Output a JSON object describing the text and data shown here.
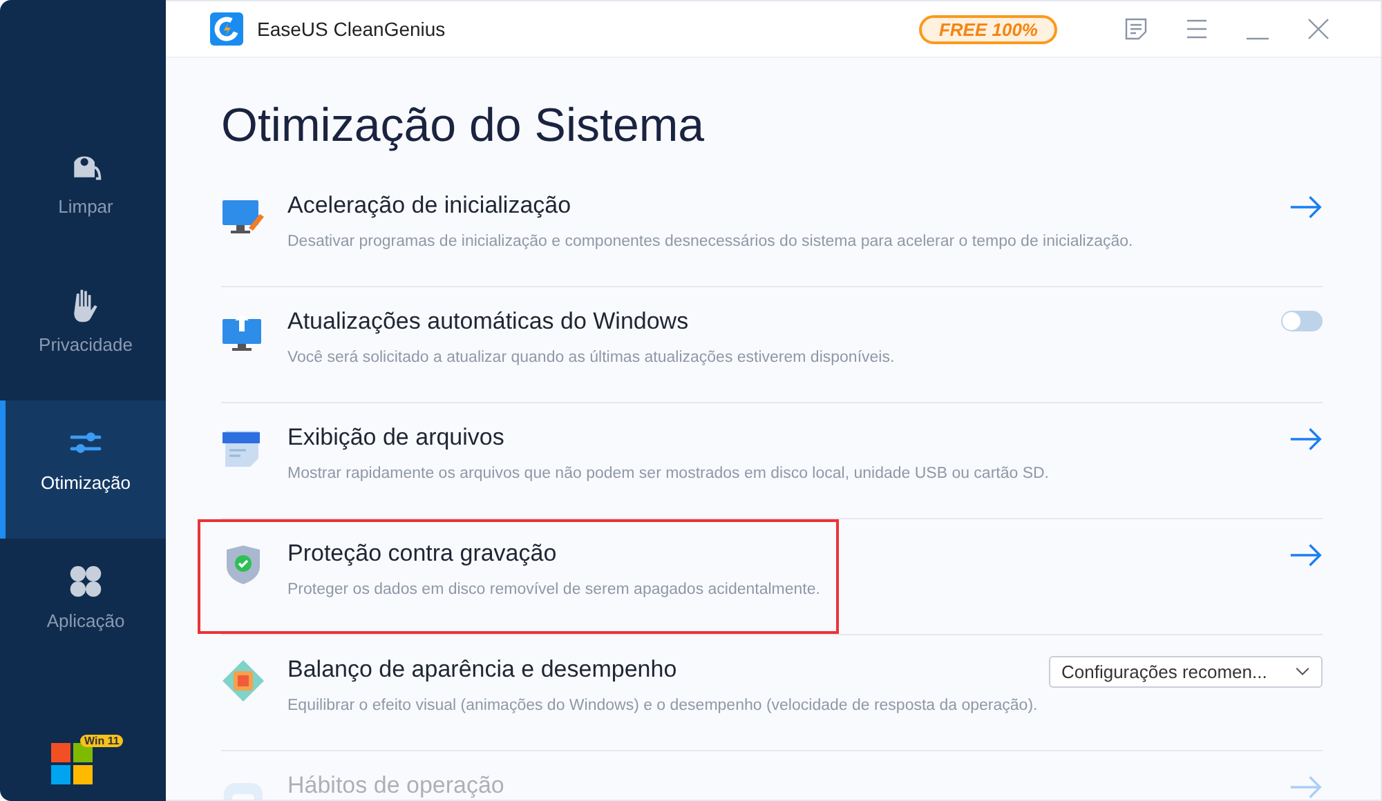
{
  "app": {
    "title": "EaseUS CleanGenius",
    "badge": "FREE 100%"
  },
  "sidebar": {
    "items": [
      {
        "label": "Limpar",
        "selected": false
      },
      {
        "label": "Privacidade",
        "selected": false
      },
      {
        "label": "Otimização",
        "selected": true
      },
      {
        "label": "Aplicação",
        "selected": false
      }
    ],
    "os_badge": "Win 11"
  },
  "heading": "Otimização do Sistema",
  "items": [
    {
      "kind": "arrow",
      "title": "Aceleração de inicialização",
      "description": "Desativar programas de inicialização e componentes desnecessários do sistema para acelerar o tempo de inicialização.",
      "highlighted": false,
      "dimmed": false
    },
    {
      "kind": "toggle",
      "title": "Atualizações automáticas do Windows",
      "description": "Você será solicitado a atualizar quando as últimas atualizações estiverem disponíveis.",
      "on": false,
      "highlighted": false,
      "dimmed": false
    },
    {
      "kind": "arrow",
      "title": "Exibição de arquivos",
      "description": "Mostrar rapidamente os arquivos que não podem ser mostrados em disco local, unidade USB ou cartão SD.",
      "highlighted": false,
      "dimmed": false
    },
    {
      "kind": "arrow",
      "title": "Proteção contra gravação",
      "description": "Proteger os dados em disco removível de serem apagados acidentalmente.",
      "highlighted": true,
      "dimmed": false
    },
    {
      "kind": "dropdown",
      "title": "Balanço de aparência e desempenho",
      "description": "Equilibrar o efeito visual (animações do Windows) e o desempenho (velocidade de resposta da operação).",
      "value": "Configurações recomen...",
      "highlighted": false,
      "dimmed": false
    },
    {
      "kind": "arrow",
      "title": "Hábitos de operação",
      "highlighted": false,
      "dimmed": true
    }
  ]
}
